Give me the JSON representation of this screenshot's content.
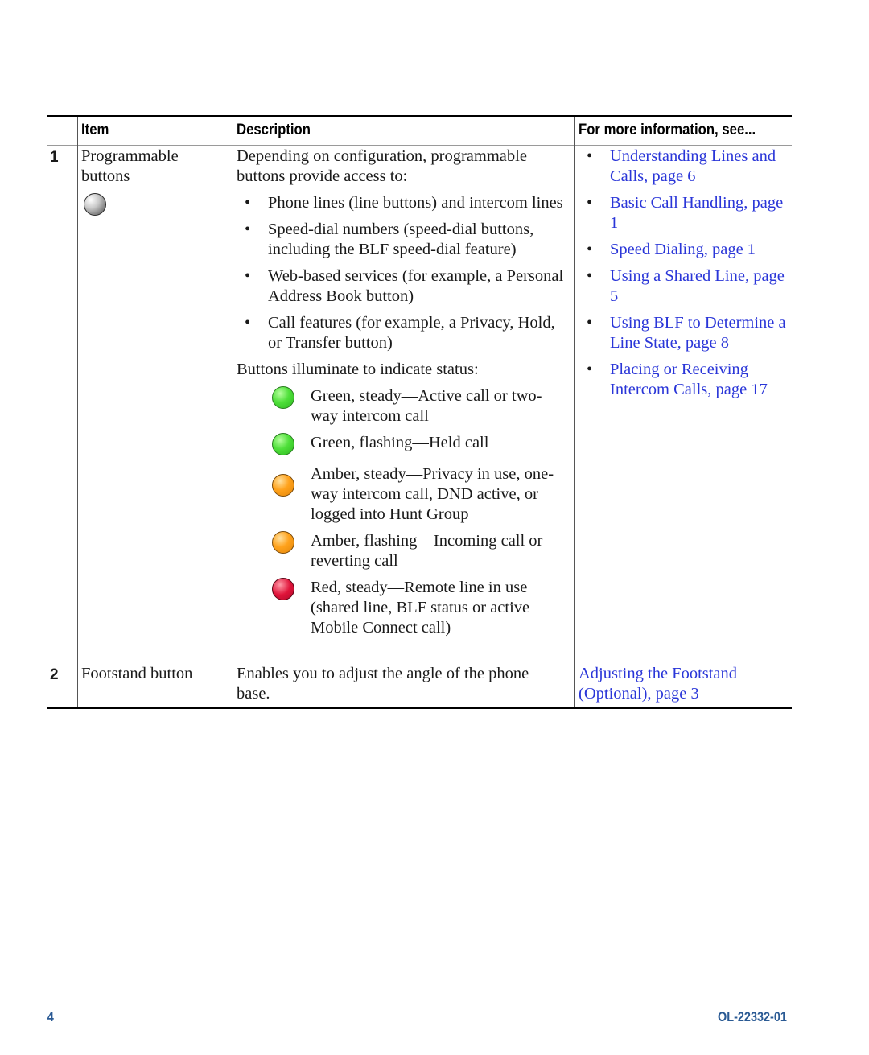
{
  "table": {
    "headers": {
      "item": "Item",
      "description": "Description",
      "more_info": "For more information, see..."
    },
    "rows": [
      {
        "number": "1",
        "item_lines": [
          "Programmable",
          "buttons"
        ],
        "item_icon": "programmable-button-icon",
        "description_intro": "Depending on configuration, programmable buttons provide access to:",
        "description_bullets": [
          "Phone lines (line buttons) and intercom lines",
          "Speed-dial numbers (speed-dial buttons, including the BLF speed-dial feature)",
          "Web-based services (for example, a Personal Address Book button)",
          "Call features (for example, a Privacy, Hold, or Transfer button)"
        ],
        "status_intro": "Buttons illuminate to indicate status:",
        "status_items": [
          {
            "color": "green",
            "text": "Green, steady—Active call or two-way intercom call"
          },
          {
            "color": "green",
            "text": "Green, flashing—Held call"
          },
          {
            "color": "amber",
            "text": "Amber, steady—Privacy in use, one-way intercom call, DND active, or logged into Hunt Group"
          },
          {
            "color": "amber",
            "text": "Amber, flashing—Incoming call or reverting call"
          },
          {
            "color": "red",
            "text": "Red, steady—Remote line in use (shared line, BLF status or active Mobile Connect call)"
          }
        ],
        "links": [
          "Understanding Lines and Calls, page 6",
          "Basic Call Handling, page 1",
          "Speed Dialing, page 1",
          "Using a Shared Line, page 5",
          "Using BLF to Determine a Line State, page 8",
          "Placing or Receiving Intercom Calls, page 17"
        ]
      },
      {
        "number": "2",
        "item_text": "Footstand button",
        "description": "Enables you to adjust the angle of the phone base.",
        "link": "Adjusting the Footstand (Optional), page 3"
      }
    ]
  },
  "footer": {
    "page_number": "4",
    "doc_id": "OL-22332-01"
  },
  "colors": {
    "link": "#2a36d8",
    "footer": "#2a5a94"
  }
}
